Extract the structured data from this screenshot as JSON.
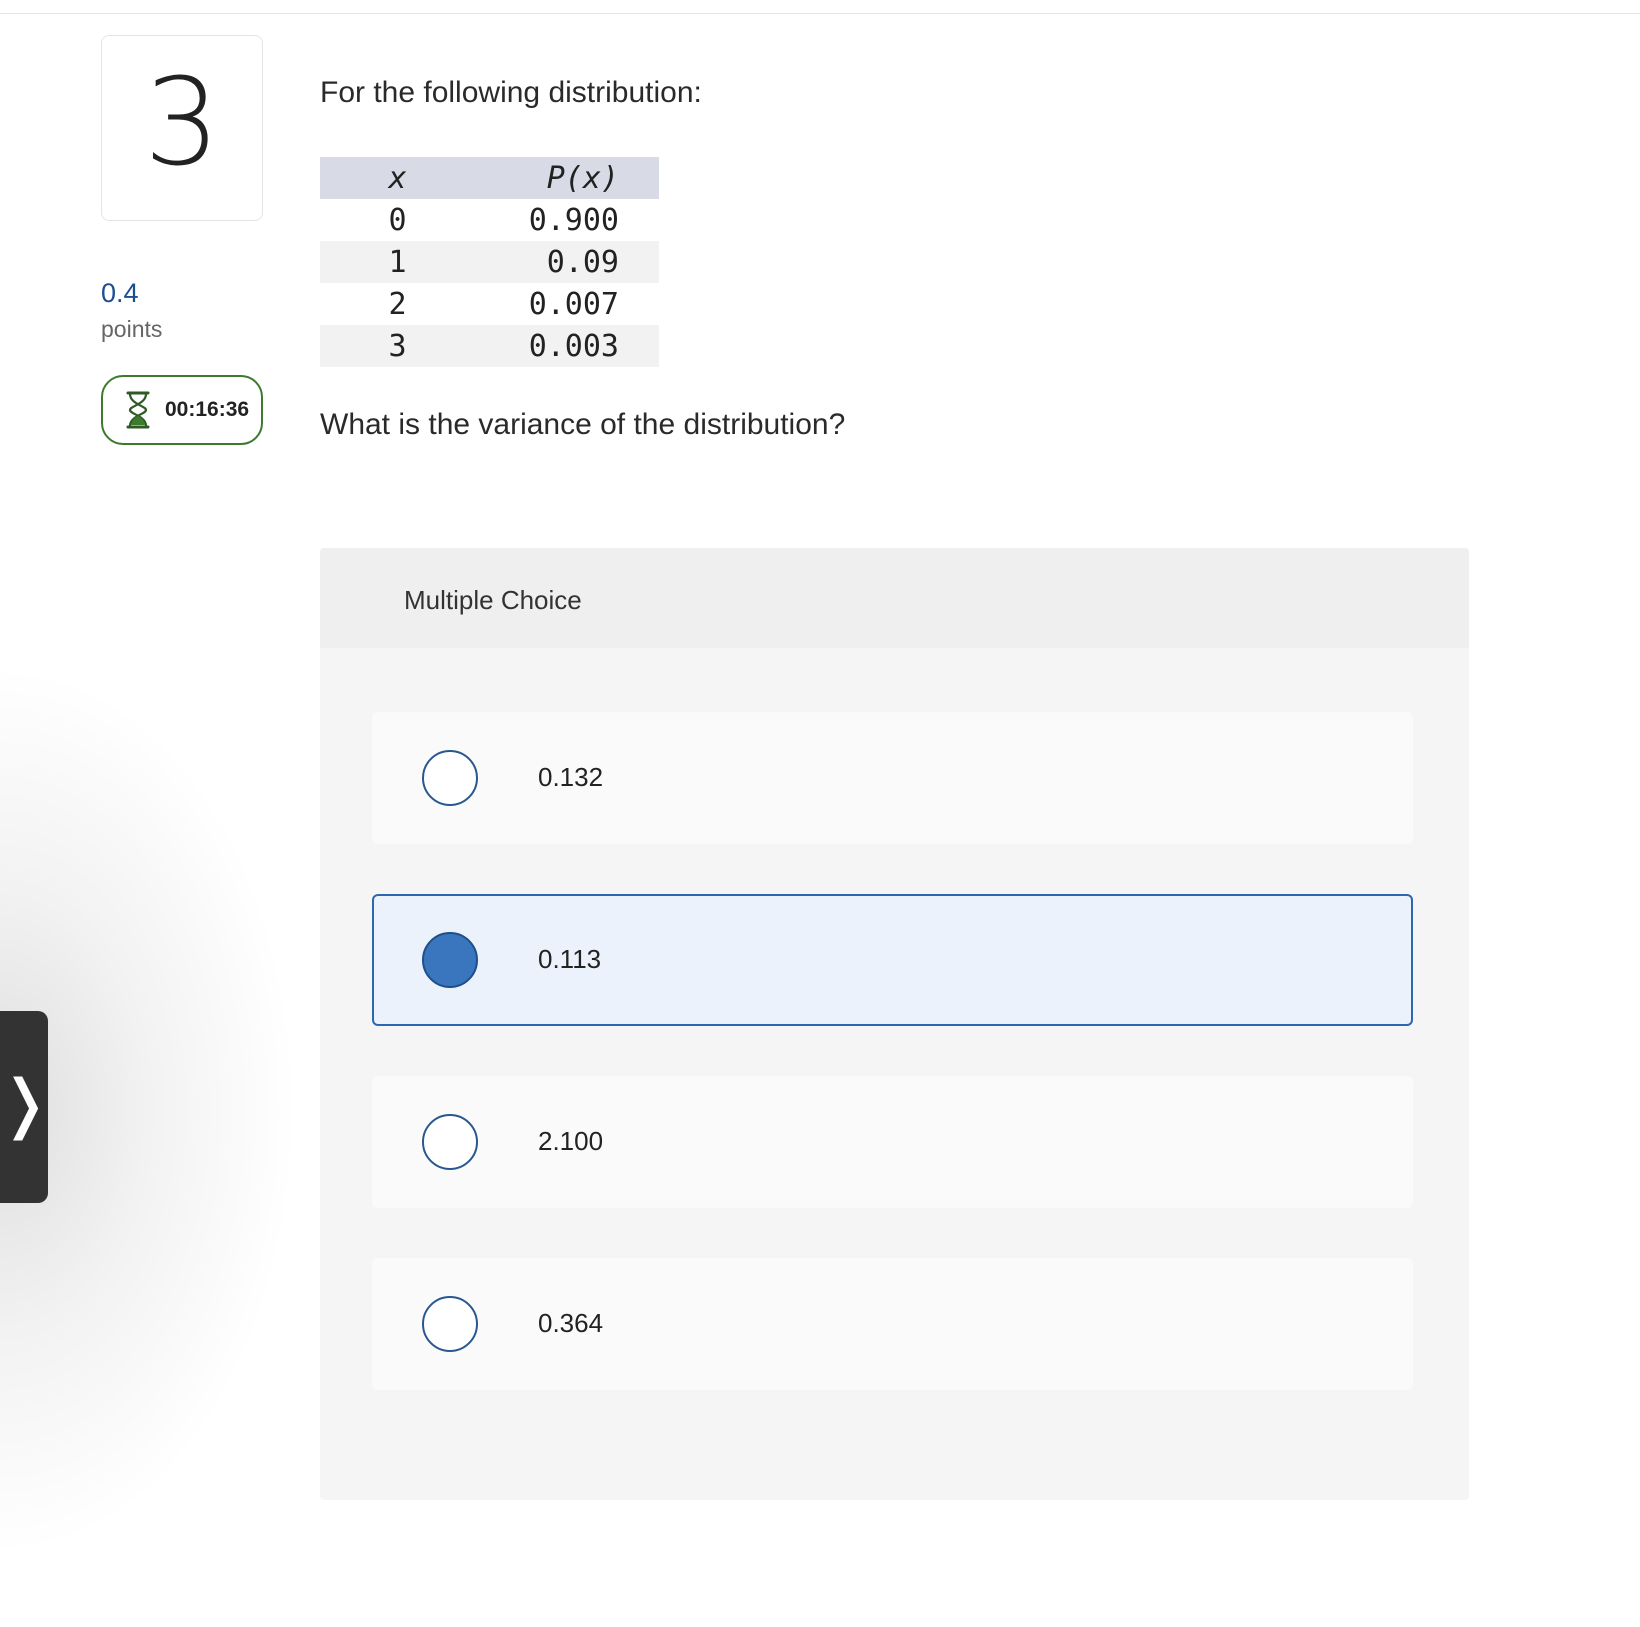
{
  "question": {
    "number": "3",
    "points_value": "0.4",
    "points_label": "points",
    "timer": "00:16:36",
    "prompt": "For the following distribution:",
    "table": {
      "headers": [
        "x",
        "P(x)"
      ],
      "rows": [
        [
          "0",
          "0.900"
        ],
        [
          "1",
          "0.09"
        ],
        [
          "2",
          "0.007"
        ],
        [
          "3",
          "0.003"
        ]
      ]
    },
    "text": "What is the variance of the distribution?"
  },
  "multiple_choice": {
    "title": "Multiple Choice",
    "options": [
      {
        "label": "0.132",
        "selected": false
      },
      {
        "label": "0.113",
        "selected": true
      },
      {
        "label": "2.100",
        "selected": false
      },
      {
        "label": "0.364",
        "selected": false
      }
    ]
  },
  "icons": {
    "timer": "hourglass-icon",
    "side_tab": "chevron-right-icon"
  },
  "colors": {
    "accent": "#2c67b1",
    "selected_fill": "#3a76bd",
    "selected_bg": "#ebf2fb",
    "timer_border": "#3d7a2e",
    "points": "#1c4f8f"
  }
}
